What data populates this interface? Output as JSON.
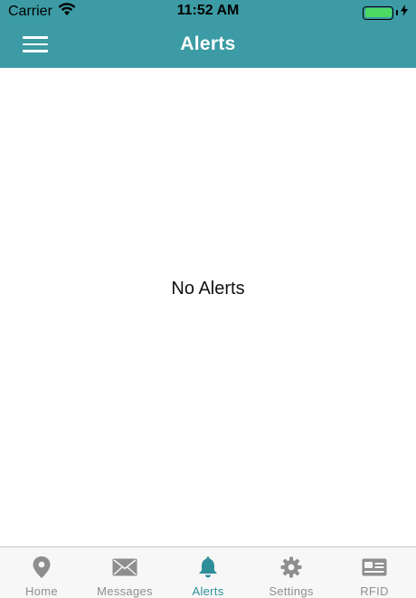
{
  "status_bar": {
    "carrier": "Carrier",
    "time": "11:52 AM",
    "wifi_icon": "wifi-icon",
    "battery_icon": "battery-icon",
    "battery_level": 1.0
  },
  "nav_bar": {
    "title": "Alerts",
    "menu_icon": "hamburger-menu-icon"
  },
  "content": {
    "empty_message": "No Alerts"
  },
  "tab_bar": {
    "active_tab": "Alerts",
    "tabs": [
      {
        "label": "Home",
        "icon": "map-pin-icon"
      },
      {
        "label": "Messages",
        "icon": "envelope-icon"
      },
      {
        "label": "Alerts",
        "icon": "bell-icon"
      },
      {
        "label": "Settings",
        "icon": "gear-icon"
      },
      {
        "label": "RFID",
        "icon": "id-card-icon"
      }
    ]
  },
  "colors": {
    "header": "#3c9ba4",
    "active_tab": "#2e8f99",
    "inactive_tab": "#8e8e8e",
    "battery": "#4cd964"
  }
}
